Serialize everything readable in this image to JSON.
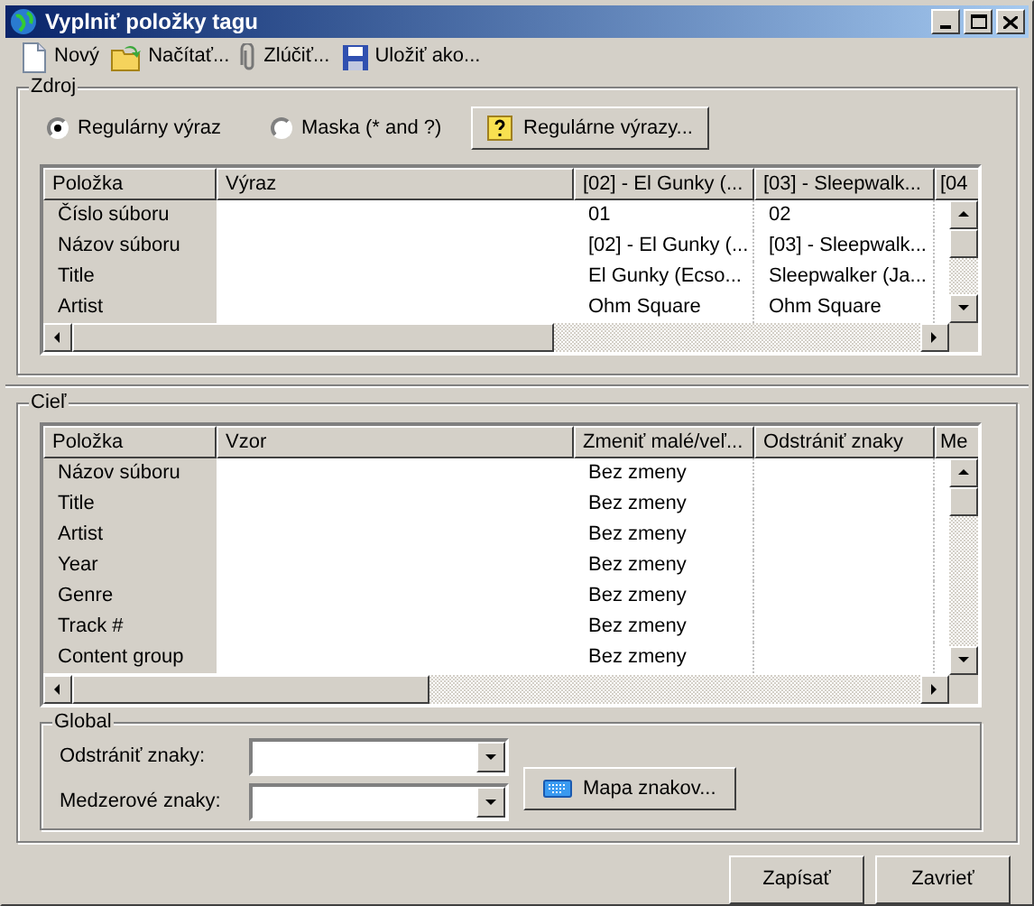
{
  "window": {
    "title": "Vyplniť položky tagu"
  },
  "toolbar": [
    {
      "label": "Nový",
      "kind": "new"
    },
    {
      "label": "Načítať...",
      "kind": "open"
    },
    {
      "label": "Zlúčiť...",
      "kind": "merge"
    },
    {
      "label": "Uložiť ako...",
      "kind": "save"
    }
  ],
  "source": {
    "title": "Zdroj",
    "radios": [
      {
        "label": "Regulárny výraz",
        "selected": true
      },
      {
        "label": "Maska (* and ?)",
        "selected": false
      }
    ],
    "help_button": "Regulárne výrazy...",
    "table": {
      "columns": [
        "Položka",
        "Výraz",
        "[02] - El Gunky (...",
        "[03] - Sleepwalk...",
        "[04"
      ],
      "rows": [
        [
          "Číslo súboru",
          "",
          "01",
          "02"
        ],
        [
          "Názov súboru",
          "",
          "[02] - El Gunky (...",
          "[03] - Sleepwalk..."
        ],
        [
          "Title",
          "",
          "El Gunky (Ecso...",
          "Sleepwalker (Ja..."
        ],
        [
          "Artist",
          "",
          "Ohm Square",
          "Ohm Square"
        ]
      ]
    }
  },
  "target": {
    "title": "Cieľ",
    "table": {
      "columns": [
        "Položka",
        "Vzor",
        "Zmeniť malé/veľ...",
        "Odstrániť znaky",
        "Me"
      ],
      "rows": [
        [
          "Názov súboru",
          "",
          "Bez zmeny",
          ""
        ],
        [
          "Title",
          "",
          "Bez zmeny",
          ""
        ],
        [
          "Artist",
          "",
          "Bez zmeny",
          ""
        ],
        [
          "Year",
          "",
          "Bez zmeny",
          ""
        ],
        [
          "Genre",
          "",
          "Bez zmeny",
          ""
        ],
        [
          "Track #",
          "",
          "Bez zmeny",
          ""
        ],
        [
          "Content group",
          "",
          "Bez zmeny",
          ""
        ]
      ]
    },
    "global": {
      "title": "Global",
      "fields": [
        {
          "label": "Odstrániť znaky:"
        },
        {
          "label": "Medzerové znaky:"
        }
      ],
      "charmap_button": "Mapa znakov..."
    }
  },
  "buttons": [
    "Zapísať",
    "Zavrieť"
  ]
}
